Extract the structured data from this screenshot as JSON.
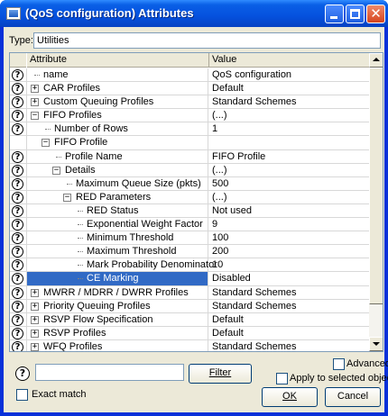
{
  "window": {
    "title": "(QoS configuration) Attributes"
  },
  "type_field": {
    "label": "Type:",
    "value": "Utilities"
  },
  "grid": {
    "columns": {
      "attribute": "Attribute",
      "value": "Value"
    },
    "rows": [
      {
        "indent": 0,
        "expander": "",
        "help": true,
        "label": "name",
        "value": "QoS configuration"
      },
      {
        "indent": 0,
        "expander": "+",
        "help": true,
        "label": "CAR Profiles",
        "value": "Default"
      },
      {
        "indent": 0,
        "expander": "+",
        "help": true,
        "label": "Custom Queuing Profiles",
        "value": "Standard Schemes"
      },
      {
        "indent": 0,
        "expander": "-",
        "help": true,
        "label": "FIFO Profiles",
        "value": "(...)"
      },
      {
        "indent": 1,
        "expander": "",
        "help": true,
        "label": "Number of Rows",
        "value": "1"
      },
      {
        "indent": 1,
        "expander": "-",
        "help": false,
        "label": "FIFO Profile",
        "value": ""
      },
      {
        "indent": 2,
        "expander": "",
        "help": true,
        "label": "Profile Name",
        "value": "FIFO Profile"
      },
      {
        "indent": 2,
        "expander": "-",
        "help": true,
        "label": "Details",
        "value": "(...)"
      },
      {
        "indent": 3,
        "expander": "",
        "help": true,
        "label": "Maximum Queue Size (pkts)",
        "value": "500"
      },
      {
        "indent": 3,
        "expander": "-",
        "help": true,
        "label": "RED Parameters",
        "value": "(...)"
      },
      {
        "indent": 4,
        "expander": "",
        "help": true,
        "label": "RED Status",
        "value": "Not used"
      },
      {
        "indent": 4,
        "expander": "",
        "help": true,
        "label": "Exponential Weight Factor",
        "value": "9"
      },
      {
        "indent": 4,
        "expander": "",
        "help": true,
        "label": "Minimum Threshold",
        "value": "100"
      },
      {
        "indent": 4,
        "expander": "",
        "help": true,
        "label": "Maximum Threshold",
        "value": "200"
      },
      {
        "indent": 4,
        "expander": "",
        "help": true,
        "label": "Mark Probability Denominator",
        "value": "10"
      },
      {
        "indent": 4,
        "expander": "",
        "help": true,
        "label": "CE Marking",
        "value": "Disabled",
        "selected": true
      },
      {
        "indent": 0,
        "expander": "+",
        "help": true,
        "label": "MWRR / MDRR / DWRR Profiles",
        "value": "Standard Schemes"
      },
      {
        "indent": 0,
        "expander": "+",
        "help": true,
        "label": "Priority Queuing Profiles",
        "value": "Standard Schemes"
      },
      {
        "indent": 0,
        "expander": "+",
        "help": true,
        "label": "RSVP Flow Specification",
        "value": "Default"
      },
      {
        "indent": 0,
        "expander": "+",
        "help": true,
        "label": "RSVP Profiles",
        "value": "Default"
      },
      {
        "indent": 0,
        "expander": "+",
        "help": true,
        "label": "WFQ Profiles",
        "value": "Standard Schemes"
      }
    ]
  },
  "filter": {
    "value": "",
    "button_label": "Filter",
    "exact_match_label": "Exact match"
  },
  "options": {
    "advanced_label": "Advanced",
    "apply_label": "Apply to selected objects"
  },
  "buttons": {
    "ok": "OK",
    "cancel": "Cancel"
  }
}
